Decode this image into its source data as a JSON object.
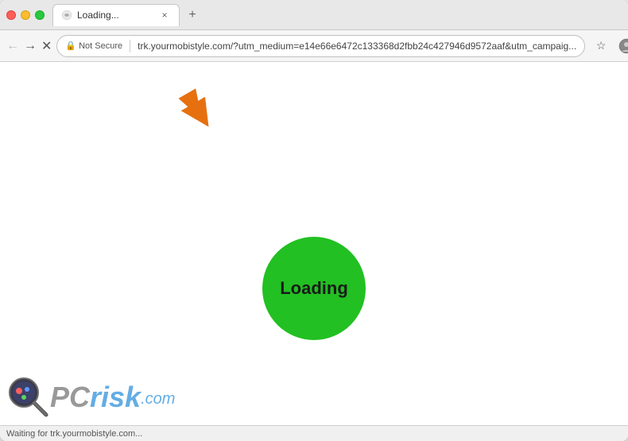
{
  "browser": {
    "tab": {
      "title": "Loading...",
      "close_label": "×"
    },
    "new_tab_label": "+",
    "nav": {
      "back_label": "←",
      "forward_label": "→",
      "reload_label": "✕"
    },
    "address_bar": {
      "security_label": "Not Secure",
      "url": "trk.yourmobistyle.com/?utm_medium=e14e66e6472c133368d2fbb24c427946d9572aaf&utm_campaig..."
    },
    "toolbar": {
      "bookmark_label": "☆",
      "profile_label": "○",
      "menu_label": "⊗"
    }
  },
  "page": {
    "loading_label": "Loading",
    "arrow_title": "orange-arrow"
  },
  "status_bar": {
    "text": "Waiting for trk.yourmobistyle.com..."
  },
  "watermark": {
    "pc_text": "PC",
    "risk_text": "risk",
    "dot_com": ".com"
  }
}
